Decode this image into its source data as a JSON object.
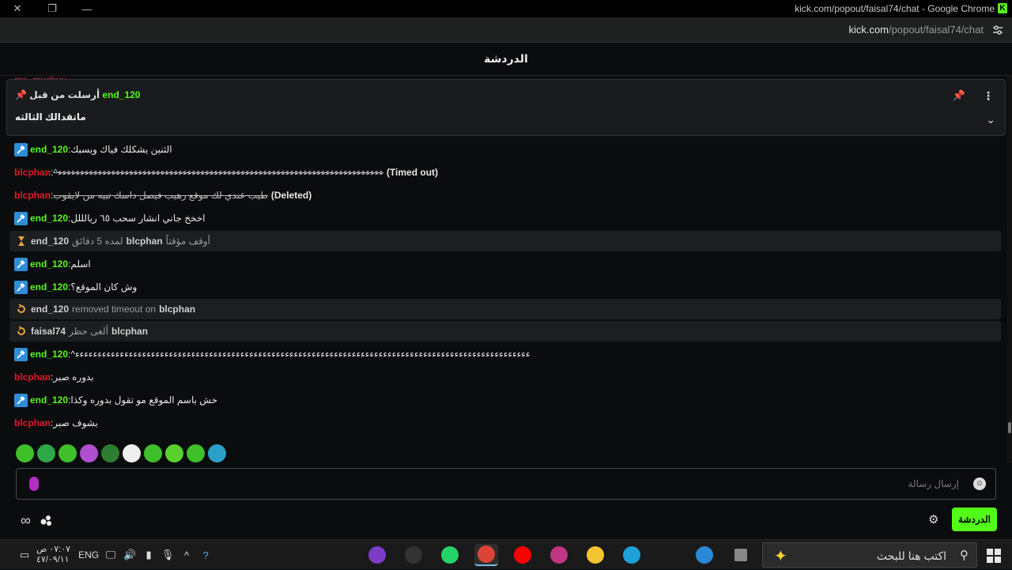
{
  "window": {
    "title": "kick.com/popout/faisal74/chat - Google Chrome",
    "controls": [
      "close-icon",
      "restore-icon",
      "minimize-icon"
    ]
  },
  "address": {
    "domain": "kick.com",
    "path": "/popout/faisal74/chat"
  },
  "chat": {
    "header": "الدردشة",
    "hidden_top_user": "mo_muchuu",
    "pinned": {
      "user": "end_120",
      "sent_by_label": "أرسلت من قبل",
      "message": "ماتقدالك الثالثه"
    },
    "messages": [
      {
        "kind": "msg",
        "badge": true,
        "user": "end_120",
        "color": "green",
        "text": "الثنين يشكلك فياك ويسبك"
      },
      {
        "kind": "msg",
        "badge": false,
        "user": "blcphan",
        "color": "red",
        "text": "ءءءءءءءءءءءءءءءءءءءءءءءءءءءءءءءءءءءءءءءءءءءءءءءءءءءءءءءءءءءءءءءءءءءءءءءءء^",
        "strike": true,
        "note": "(Timed out)"
      },
      {
        "kind": "msg",
        "badge": false,
        "user": "blcphan",
        "color": "red",
        "text": "طيب عندي لك موقع رهيب فيصل داسك تبيه من لايقوب",
        "strike": true,
        "note": "(Deleted)"
      },
      {
        "kind": "msg",
        "badge": true,
        "user": "end_120",
        "color": "green",
        "text": "اخخخ جاني انشار سحب ٦٥ ريالللل"
      },
      {
        "kind": "sys",
        "icon": "hourglass",
        "actor": "end_120",
        "middle": "لمده 5 دقائق",
        "target": "blcphan",
        "action": "أوقف مؤقتاً"
      },
      {
        "kind": "msg",
        "badge": true,
        "user": "end_120",
        "color": "green",
        "text": "اسلم"
      },
      {
        "kind": "msg",
        "badge": true,
        "user": "end_120",
        "color": "green",
        "text": "وش كان الموقع؟"
      },
      {
        "kind": "sys",
        "icon": "undo",
        "actor": "end_120",
        "middle": "removed timeout on",
        "target": "blcphan",
        "action": ""
      },
      {
        "kind": "sys",
        "icon": "undo",
        "actor": "faisal74",
        "middle": "ألغى حظر",
        "target": "blcphan",
        "action": ""
      },
      {
        "kind": "msg",
        "badge": true,
        "user": "end_120",
        "color": "green",
        "text": "ءءءءءءءءءءءءءءءءءءءءءءءءءءءءءءءءءءءءءءءءءءءءءءءءءءءءءءءءءءءءءءءءءءءءءءءءءءءءءءءءءءءءءءءءءءءءءءءءءءءءءء^"
      },
      {
        "kind": "msg",
        "badge": false,
        "user": "blcphan",
        "color": "red",
        "text": "بدوره صبر"
      },
      {
        "kind": "msg",
        "badge": true,
        "user": "end_120",
        "color": "green",
        "text": "خش باسم الموقع مو تقول بدوره وكذا"
      },
      {
        "kind": "msg",
        "badge": false,
        "user": "blcphan",
        "color": "red",
        "text": "بشوف صبر"
      }
    ],
    "emotes": [
      "emote-1",
      "emote-2",
      "emote-3",
      "emote-4",
      "emote-5",
      "emote-6",
      "emote-7",
      "emote-8",
      "emote-9",
      "emote-10"
    ],
    "input_placeholder": "إرسال رسالة",
    "chat_button": "الدردشة"
  },
  "taskbar": {
    "time": "٠٧:٠٧ ص",
    "date": "٤٧/٠٩/١١",
    "lang": "ENG",
    "search_text": "اكتب هنا للبحث",
    "apps": [
      "app-icon-1",
      "obs-icon",
      "whatsapp-icon",
      "chrome-icon",
      "youtube-icon",
      "office-icon",
      "files-icon",
      "edge-icon",
      "mail-icon",
      "taskview-icon"
    ]
  },
  "colors": {
    "kick_green": "#53fc18",
    "user_red": "#e0182e",
    "badge_blue": "#2f8fd6"
  }
}
